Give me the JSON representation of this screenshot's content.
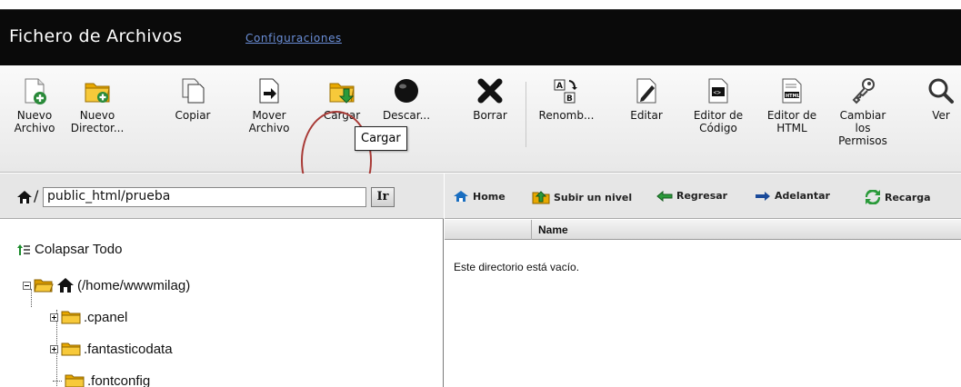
{
  "header": {
    "title": "Fichero de Archivos",
    "settings_link": "Configuraciones"
  },
  "toolbar": {
    "buttons": [
      {
        "label": "Nuevo Archivo",
        "icon": "new-file-icon"
      },
      {
        "label": "Nuevo Director...",
        "icon": "new-folder-icon"
      },
      {
        "label": "Copiar",
        "icon": "copy-icon"
      },
      {
        "label": "Mover Archivo",
        "icon": "move-file-icon"
      },
      {
        "label": "Cargar",
        "icon": "upload-icon"
      },
      {
        "label": "Descar...",
        "icon": "download-icon"
      },
      {
        "label": "Borrar",
        "icon": "delete-icon"
      },
      {
        "label": "Renomb...",
        "icon": "rename-icon"
      },
      {
        "label": "Editar",
        "icon": "edit-icon"
      },
      {
        "label": "Editor de Código",
        "icon": "code-editor-icon"
      },
      {
        "label": "Editor de HTML",
        "icon": "html-editor-icon"
      },
      {
        "label": "Cambiar los Permisos",
        "icon": "permissions-icon"
      },
      {
        "label": "Ver",
        "icon": "view-icon"
      }
    ],
    "tooltip": "Cargar"
  },
  "left_panel": {
    "path_separator": "/",
    "path_value": "public_html/prueba",
    "go_label": "Ir",
    "collapse_label": "Colapsar Todo",
    "root_label": "(/home/wwwmilag)",
    "folders": [
      ".cpanel",
      ".fantasticodata",
      ".fontconfig"
    ]
  },
  "right_panel": {
    "nav": {
      "home": "Home",
      "up": "Subir un nivel",
      "back": "Regresar",
      "forward": "Adelantar",
      "reload": "Recarga"
    },
    "column_name": "Name",
    "empty_message": "Este directorio está vacío."
  },
  "colors": {
    "title_bar": "#0a0a0a",
    "link": "#6b8fd8",
    "highlight": "#a83a36",
    "folder": "#f0b400"
  }
}
